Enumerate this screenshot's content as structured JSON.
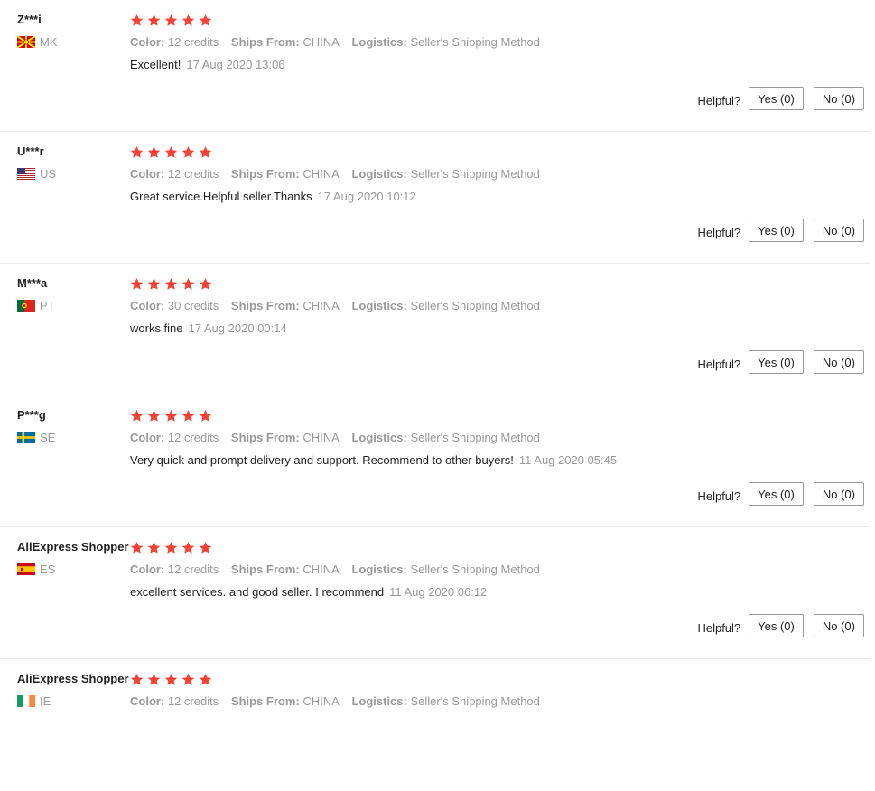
{
  "labels": {
    "color": "Color:",
    "ships_from": "Ships From:",
    "logistics": "Logistics:",
    "helpful": "Helpful?"
  },
  "colors": {
    "star": "#f44336",
    "muted_text": "#999999",
    "divider": "#e8e8e8"
  },
  "reviews": [
    {
      "user": "Z***i",
      "country": "MK",
      "flag_icon": "flag-mk-icon",
      "rating": 5,
      "color": "12 credits",
      "ships_from": "CHINA",
      "logistics": "Seller's Shipping Method",
      "text": "Excellent!",
      "time": "17 Aug 2020 13:06",
      "yes": "Yes (0)",
      "no": "No (0)"
    },
    {
      "user": "U***r",
      "country": "US",
      "flag_icon": "flag-us-icon",
      "rating": 5,
      "color": "12 credits",
      "ships_from": "CHINA",
      "logistics": "Seller's Shipping Method",
      "text": "Great service.Helpful seller.Thanks",
      "time": "17 Aug 2020 10:12",
      "yes": "Yes (0)",
      "no": "No (0)"
    },
    {
      "user": "M***a",
      "country": "PT",
      "flag_icon": "flag-pt-icon",
      "rating": 5,
      "color": "30 credits",
      "ships_from": "CHINA",
      "logistics": "Seller's Shipping Method",
      "text": "works fine",
      "time": "17 Aug 2020 00:14",
      "yes": "Yes (0)",
      "no": "No (0)"
    },
    {
      "user": "P***g",
      "country": "SE",
      "flag_icon": "flag-se-icon",
      "rating": 5,
      "color": "12 credits",
      "ships_from": "CHINA",
      "logistics": "Seller's Shipping Method",
      "text": "Very quick and prompt delivery and support. Recommend to other buyers!",
      "time": "11 Aug 2020 05:45",
      "yes": "Yes (0)",
      "no": "No (0)"
    },
    {
      "user": "AliExpress Shopper",
      "country": "ES",
      "flag_icon": "flag-es-icon",
      "rating": 5,
      "color": "12 credits",
      "ships_from": "CHINA",
      "logistics": "Seller's Shipping Method",
      "text": "excellent services. and good seller. I recommend",
      "time": "11 Aug 2020 06:12",
      "yes": "Yes (0)",
      "no": "No (0)"
    },
    {
      "user": "AliExpress Shopper",
      "country": "IE",
      "flag_icon": "flag-ie-icon",
      "rating": 5,
      "color": "12 credits",
      "ships_from": "CHINA",
      "logistics": "Seller's Shipping Method"
    }
  ]
}
